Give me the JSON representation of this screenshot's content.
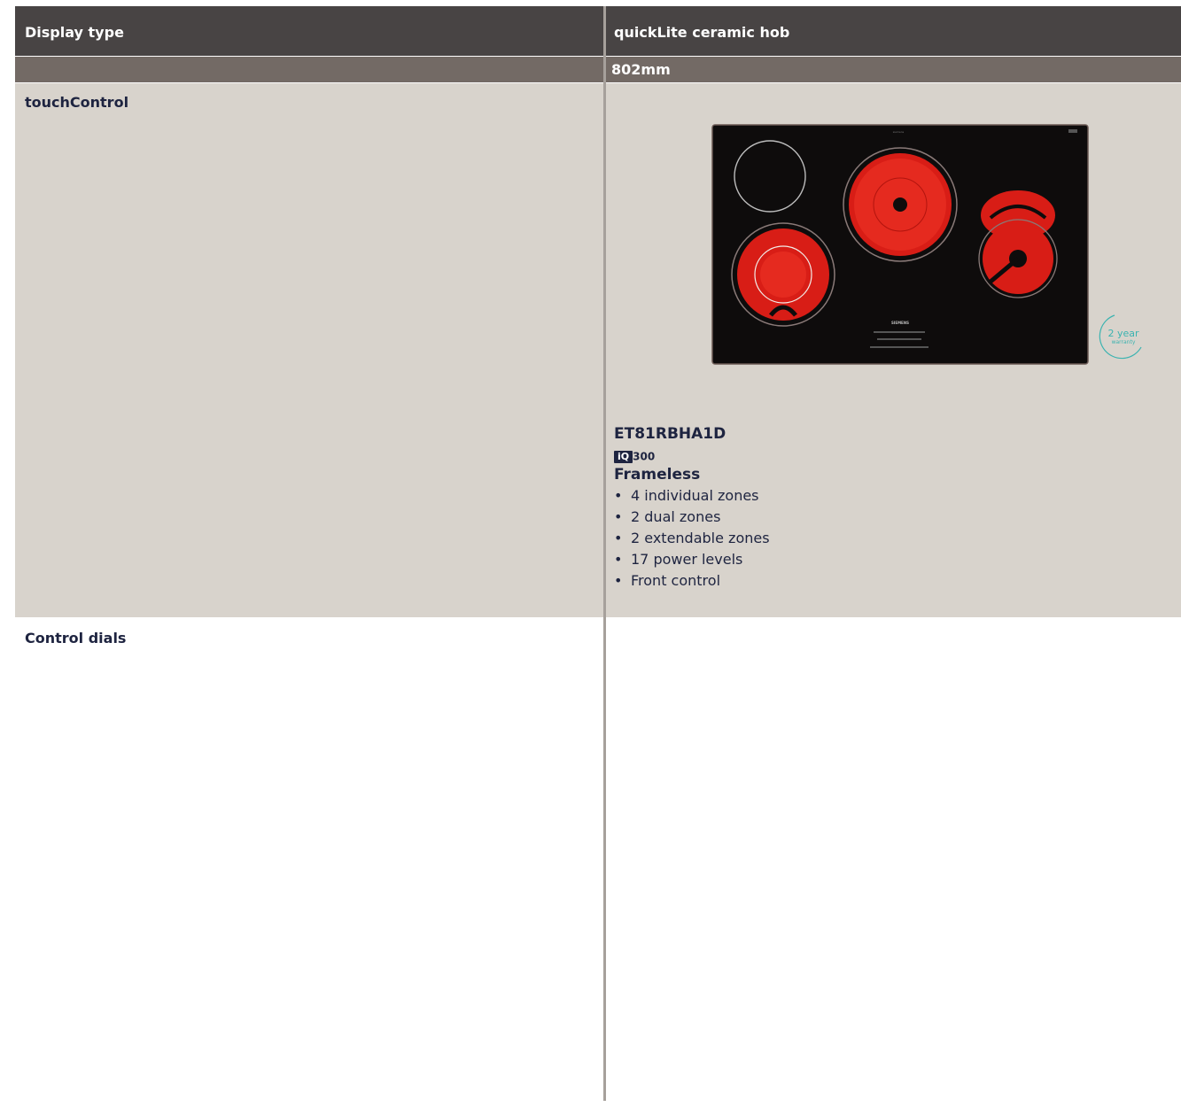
{
  "table": {
    "header": {
      "left_label": "Display type",
      "right_label": "quickLite ceramic hob"
    },
    "subheader": {
      "left_value": "",
      "right_value": "802mm"
    },
    "rows": [
      {
        "label": "touchControl",
        "product": {
          "model": "ET81RBHA1D",
          "series_badge": "iQ",
          "series_number": "300",
          "feature_title": "Frameless",
          "features": [
            "4 individual zones",
            "2 dual zones",
            "2 extendable zones",
            "17 power levels",
            "Front control"
          ],
          "image_alt": "ceramic hob",
          "warranty_years": "2 year",
          "warranty_word": "warranty",
          "brand": "SIEMENS"
        }
      },
      {
        "label": "Control dials"
      }
    ]
  },
  "colors": {
    "header_bg": "#484444",
    "subheader_bg": "#736a65",
    "row_bg": "#d8d3cc",
    "text": "#1e2440",
    "hob_red": "#e0201a",
    "warranty": "#3bb3b0"
  }
}
